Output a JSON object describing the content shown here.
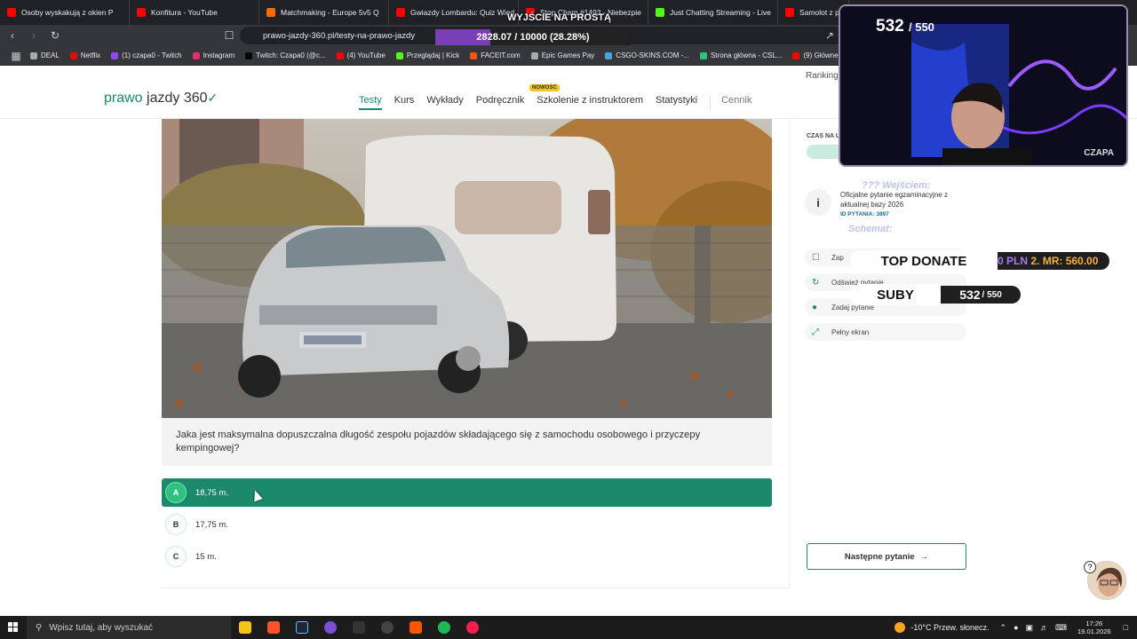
{
  "browser": {
    "tabs": [
      {
        "title": "Osoby wyskakują z okien P",
        "color": "#ff0000"
      },
      {
        "title": "Konfitura - YouTube",
        "color": "#ff0000"
      },
      {
        "title": "Matchmaking - Europe 5v5 Q",
        "color": "#ff6a00"
      },
      {
        "title": "Gwiazdy Lombardu: Quiz Wied",
        "color": "#ff0000"
      },
      {
        "title": "Stop Cham #1493 - Niebezpie",
        "color": "#ff0000"
      },
      {
        "title": "Just Chatting Streaming - Live",
        "color": "#53fc18"
      },
      {
        "title": "Samolot z pasażer",
        "color": "#ff0000"
      }
    ],
    "url": "prawo-jazdy-360.pl/testy-na-prawo-jazdy",
    "bookmarks": [
      {
        "label": "DEAL",
        "color": "#aaa"
      },
      {
        "label": "Netflix",
        "color": "#e50914"
      },
      {
        "label": "(1) czapa0 - Twitch",
        "color": "#9146ff"
      },
      {
        "label": "Instagram",
        "color": "#e1306c"
      },
      {
        "label": "Twitch: Czapa0 (@c...",
        "color": "#000000"
      },
      {
        "label": "(4) YouTube",
        "color": "#ff0000"
      },
      {
        "label": "Przeglądaj | Kick",
        "color": "#53fc18"
      },
      {
        "label": "FACEIT.com",
        "color": "#ff5500"
      },
      {
        "label": "Epic Games Pay",
        "color": "#aaa"
      },
      {
        "label": "CSGO-SKINS.COM -...",
        "color": "#4aa3df"
      },
      {
        "label": "Strona główna - CSL...",
        "color": "#2ec27e"
      },
      {
        "label": "(9) Główne",
        "color": "#ff0000"
      }
    ]
  },
  "stream": {
    "goal_title": "WYJŚCIE NA PROSTĄ",
    "goal_progress": "2828.07 / 10000 (28.28%)",
    "goal_fraction": 0.2828,
    "cam_count": "532",
    "cam_total": "/ 550",
    "cam_name": "CZAPA",
    "top_donate_label": "TOP DONATE",
    "top_donate_value": "0 PLN",
    "top_donate_second": "2. MR: 560.00",
    "subs_label": "SUBY",
    "subs_count": "532",
    "subs_total": "/ 550",
    "floating_1": "??? Wejściem:",
    "floating_2": "Schemat:"
  },
  "site": {
    "logo_a": "prawo",
    "logo_b": "jazdy 360",
    "nav": [
      "Testy",
      "Kurs",
      "Wykłady",
      "Podręcznik",
      "Szkolenie z instruktorem",
      "Statystyki",
      "Cennik"
    ],
    "new_badge": "NOWOŚĆ",
    "ranking": "Ranking"
  },
  "question": {
    "text": "Jaka jest maksymalna dopuszczalna długość zespołu pojazdów składającego się z samochodu osobowego i przyczepy kempingowej?",
    "answers": [
      {
        "letter": "A",
        "text": "18,75 m.",
        "selected": true
      },
      {
        "letter": "B",
        "text": "17,75 m.",
        "selected": false
      },
      {
        "letter": "C",
        "text": "15 m.",
        "selected": false
      }
    ]
  },
  "sidebar": {
    "timer_label": "CZAS NA U",
    "info_text": "Oficjalne pytanie egzaminacyjne z aktualnej bazy 2026",
    "info_id": "ID PYTANIA: 3897",
    "actions": [
      {
        "label": "Zap",
        "icon": "bookmark-icon"
      },
      {
        "label": "Odśwież pytanie",
        "icon": "refresh-icon"
      },
      {
        "label": "Zadaj pytanie",
        "icon": "chat-icon"
      },
      {
        "label": "Pełny ekran",
        "icon": "fullscreen-icon"
      }
    ],
    "next_button": "Następne pytanie"
  },
  "taskbar": {
    "search_placeholder": "Wpisz tutaj, aby wyszukać",
    "weather": "-10°C  Przew. słonecz.",
    "time": "17:26",
    "date": "19.01.2026"
  }
}
